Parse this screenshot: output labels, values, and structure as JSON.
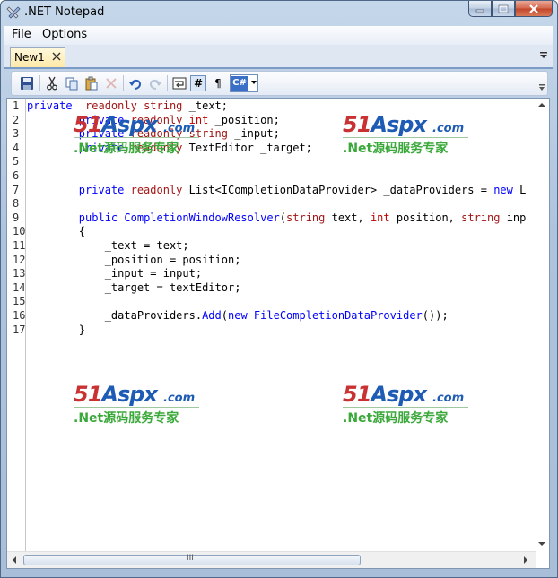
{
  "window": {
    "title": ".NET Notepad"
  },
  "menu": {
    "items": [
      "File",
      "Options"
    ]
  },
  "tabs": [
    {
      "label": "New1"
    }
  ],
  "toolbar": {
    "buttons": [
      "save-icon",
      "cut-icon",
      "copy-icon",
      "paste-icon",
      "delete-icon",
      "undo-icon",
      "redo-icon",
      "word-wrap-icon",
      "line-numbers-icon",
      "show-spaces-icon"
    ],
    "line_numbers_glyph": "#",
    "pilcrow_glyph": "¶",
    "language": "C#"
  },
  "editor": {
    "line_numbers": [
      "1",
      "2",
      "3",
      "4",
      "5",
      "6",
      "7",
      "8",
      "9",
      "10",
      "11",
      "12",
      "13",
      "14",
      "15",
      "16",
      "17"
    ],
    "lines": [
      [
        [
          "kw",
          "private"
        ],
        [
          "",
          "  "
        ],
        [
          "kw2",
          "readonly"
        ],
        [
          "",
          " "
        ],
        [
          "kw2",
          "string"
        ],
        [
          "",
          " _text;"
        ]
      ],
      [
        [
          "",
          "        "
        ],
        [
          "kw",
          "private"
        ],
        [
          "",
          " "
        ],
        [
          "kw2",
          "readonly"
        ],
        [
          "",
          " "
        ],
        [
          "kw3",
          "int"
        ],
        [
          "",
          " _position;"
        ]
      ],
      [
        [
          "",
          "        "
        ],
        [
          "kw",
          "private"
        ],
        [
          "",
          " "
        ],
        [
          "kw2",
          "readonly"
        ],
        [
          "",
          " "
        ],
        [
          "kw2",
          "string"
        ],
        [
          "",
          " _input;"
        ]
      ],
      [
        [
          "",
          "        "
        ],
        [
          "kw",
          "private"
        ],
        [
          "",
          " "
        ],
        [
          "kw2",
          "readonly"
        ],
        [
          "",
          " TextEditor _target;"
        ]
      ],
      [],
      [],
      [
        [
          "",
          "        "
        ],
        [
          "kw",
          "private"
        ],
        [
          "",
          " "
        ],
        [
          "kw2",
          "readonly"
        ],
        [
          "",
          " List<ICompletionDataProvider> _dataProviders = "
        ],
        [
          "kw",
          "new"
        ],
        [
          "",
          " L"
        ]
      ],
      [],
      [
        [
          "",
          "        "
        ],
        [
          "kw",
          "public"
        ],
        [
          "",
          " "
        ],
        [
          "kw",
          "CompletionWindowResolver"
        ],
        [
          "",
          "("
        ],
        [
          "kw2",
          "string"
        ],
        [
          "",
          " text, "
        ],
        [
          "kw3",
          "int"
        ],
        [
          "",
          " position, "
        ],
        [
          "kw2",
          "string"
        ],
        [
          "",
          " inp"
        ]
      ],
      [
        [
          "",
          "        {"
        ]
      ],
      [
        [
          "",
          "            _text = text;"
        ]
      ],
      [
        [
          "",
          "            _position = position;"
        ]
      ],
      [
        [
          "",
          "            _input = input;"
        ]
      ],
      [
        [
          "",
          "            _target = textEditor;"
        ]
      ],
      [],
      [
        [
          "",
          "            _dataProviders."
        ],
        [
          "kw",
          "Add"
        ],
        [
          "",
          "("
        ],
        [
          "kw",
          "new"
        ],
        [
          "",
          " "
        ],
        [
          "kw",
          "FileCompletionDataProvider"
        ],
        [
          "",
          "());"
        ]
      ],
      [
        [
          "",
          "        }"
        ]
      ]
    ]
  },
  "watermark": {
    "brand_red": "51",
    "brand_blue": "Aspx",
    "domain": ".com",
    "subtitle": ".Net源码服务专家"
  },
  "scrollbar": {
    "grip": "III"
  },
  "colors": {
    "keyword": "#0000ff",
    "modifier": "#a31515",
    "accent": "#3a6fc7"
  }
}
